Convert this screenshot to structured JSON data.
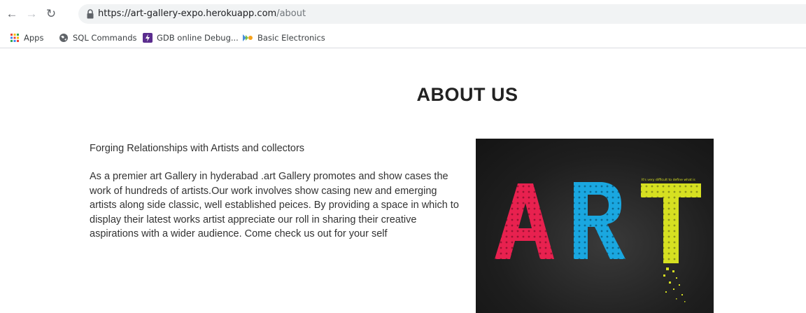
{
  "browser": {
    "url_host": "https://art-gallery-expo.herokuapp.com",
    "url_path": "/about",
    "bookmarks": [
      {
        "label": "Apps",
        "icon": "apps-grid-icon"
      },
      {
        "label": "SQL Commands",
        "icon": "globe-icon"
      },
      {
        "label": "GDB online Debug...",
        "icon": "gdb-bolt-icon"
      },
      {
        "label": "Basic Electronics",
        "icon": "electronics-icon"
      }
    ]
  },
  "page": {
    "title": "ABOUT US",
    "subtitle": "Forging Relationships with Artists and collectors",
    "paragraph": "As a premier art Gallery in hyderabad .art Gallery promotes and show cases the work of hundreds of artists.Our work involves show casing new and emerging artists along side classic, well established peices. By providing a space in which to display their latest works artist appreciate our roll in sharing their creative aspirations with a wider audience. Come check us out for your self",
    "image": {
      "word": "ART",
      "caption": "It's very difficult to define what is",
      "colors": {
        "a": "#e8214f",
        "r": "#1aa7e0",
        "t": "#d6e021"
      }
    }
  }
}
